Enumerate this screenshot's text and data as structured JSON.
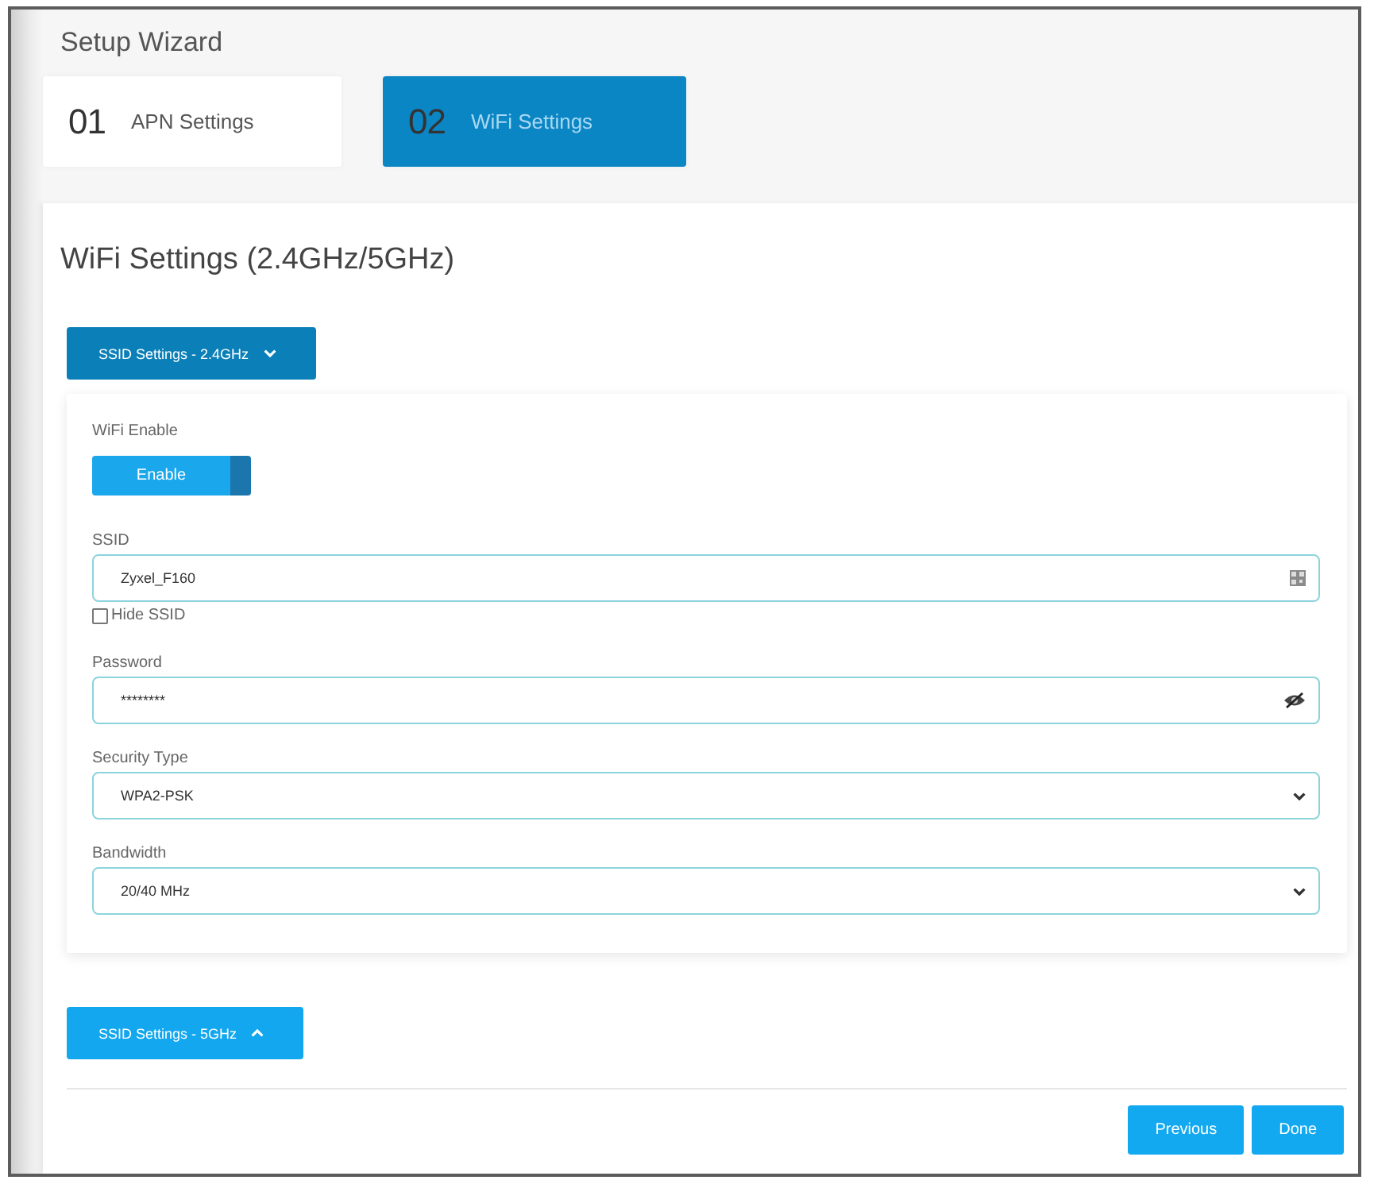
{
  "title": "Setup Wizard",
  "steps": [
    {
      "number": "01",
      "label": "APN Settings",
      "selected": false
    },
    {
      "number": "02",
      "label": "WiFi Settings",
      "selected": true
    }
  ],
  "section_title": "WiFi Settings (2.4GHz/5GHz)",
  "bands": [
    {
      "label": "SSID Settings - 2.4GHz",
      "expanded": true,
      "wifi_enable": {
        "label": "WiFi Enable",
        "toggle": {
          "label": "Enable",
          "on": true
        }
      },
      "fields": [
        {
          "kind": "text",
          "label": "SSID",
          "value": "Zyxel_F160",
          "checkbox": {
            "label": "Hide SSID",
            "checked": false
          }
        },
        {
          "kind": "password",
          "label": "Password",
          "value": "********"
        },
        {
          "kind": "select",
          "label": "Security Type",
          "value": "WPA2-PSK"
        },
        {
          "kind": "select",
          "label": "Bandwidth",
          "value": "20/40 MHz"
        }
      ]
    },
    {
      "label": "SSID Settings - 5GHz",
      "expanded": false
    }
  ],
  "buttons": [
    {
      "label": "Previous"
    },
    {
      "label": "Done"
    }
  ]
}
